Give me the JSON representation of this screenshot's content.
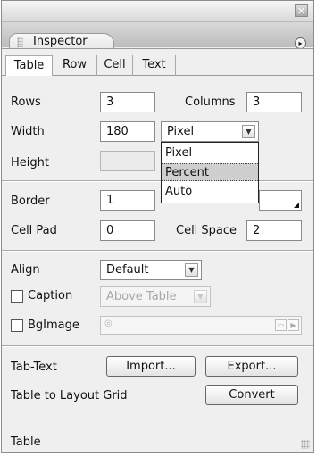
{
  "panel": {
    "title": "Inspector",
    "close_glyph": "×",
    "options_glyph": "▸",
    "tabs": [
      {
        "label": "Table",
        "active": true
      },
      {
        "label": "Row",
        "active": false
      },
      {
        "label": "Cell",
        "active": false
      },
      {
        "label": "Text",
        "active": false
      }
    ]
  },
  "dimensions": {
    "rows_label": "Rows",
    "rows_value": "3",
    "columns_label": "Columns",
    "columns_value": "3",
    "width_label": "Width",
    "width_value": "180",
    "width_unit": "Pixel",
    "height_label": "Height",
    "height_value": ""
  },
  "unit_dropdown": {
    "options": [
      "Pixel",
      "Percent",
      "Auto"
    ],
    "highlighted": "Percent"
  },
  "spacing": {
    "border_label": "Border",
    "border_value": "1",
    "cellpad_label": "Cell Pad",
    "cellpad_value": "0",
    "cellspace_label": "Cell Space",
    "cellspace_value": "2"
  },
  "layout": {
    "align_label": "Align",
    "align_value": "Default",
    "caption_label": "Caption",
    "caption_value": "Above Table",
    "bgimage_label": "BgImage",
    "bgimage_value": ""
  },
  "actions": {
    "tabtext_label": "Tab-Text",
    "import_label": "Import...",
    "export_label": "Export...",
    "layoutgrid_label": "Table to Layout Grid",
    "convert_label": "Convert"
  },
  "status": {
    "text": "Table"
  },
  "icons": {
    "close": "close-icon",
    "options": "options-menu-icon",
    "dropdown": "chevron-down-icon",
    "browse": "folder-icon",
    "next": "play-icon"
  }
}
